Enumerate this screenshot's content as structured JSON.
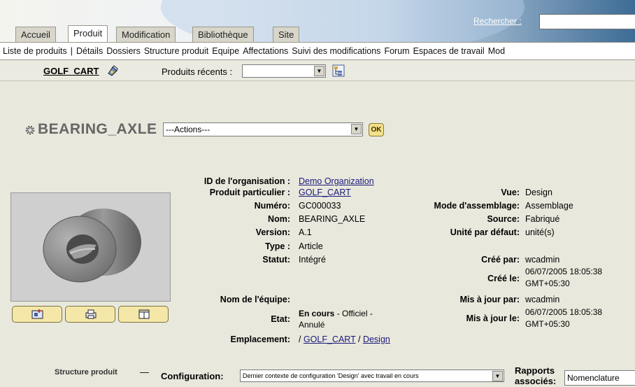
{
  "tabs": [
    {
      "label": "Accueil",
      "active": false
    },
    {
      "label": "Produit",
      "active": true
    },
    {
      "label": "Modification",
      "active": false
    },
    {
      "label": "Bibliothèque",
      "active": false
    },
    {
      "label": "Site",
      "active": false
    }
  ],
  "search": {
    "label": "Rechercher :",
    "value": ""
  },
  "subnav": [
    "Liste de produits",
    "|",
    "Détails",
    "Dossiers",
    "Structure produit",
    "Equipe",
    "Affectations",
    "Suivi des modifications",
    "Forum",
    "Espaces de travail",
    "Mod"
  ],
  "context": {
    "product": "GOLF_CART",
    "recent_label": "Produits récents :",
    "recent_value": ""
  },
  "title": "BEARING_AXLE",
  "actions": {
    "value": "---Actions---",
    "ok_label": "OK"
  },
  "attributes_left": [
    {
      "label": "ID de l'organisation :",
      "value": "Demo Organization",
      "link": true
    },
    {
      "label": "Produit particulier :",
      "value": "GOLF_CART",
      "link": true
    },
    {
      "label": "Numéro:",
      "value": "GC000033"
    },
    {
      "label": "Nom:",
      "value": "BEARING_AXLE"
    },
    {
      "label": "Version:",
      "value": "A.1"
    },
    {
      "label": "Type :",
      "value": "Article"
    },
    {
      "label": "Statut:",
      "value": "Intégré"
    }
  ],
  "attributes_right": [
    {
      "label": "Vue:",
      "value": "Design"
    },
    {
      "label": "Mode d'assemblage:",
      "value": "Assemblage"
    },
    {
      "label": "Source:",
      "value": "Fabriqué"
    },
    {
      "label": "Unité par défaut:",
      "value": "unité(s)"
    }
  ],
  "team": {
    "label": "Nom de l'équipe:",
    "value": ""
  },
  "etat": {
    "label": "Etat:",
    "value_bold": "En cours",
    "value_rest": " - Officiel -",
    "value_line2": "Annulé"
  },
  "emplacement": {
    "label": "Emplacement:",
    "prefix": "/ ",
    "link1": "GOLF_CART",
    "sep": " / ",
    "link2": "Design"
  },
  "history": {
    "created_by_label": "Créé par:",
    "created_by": "wcadmin",
    "created_on_label": "Créé le:",
    "created_on_1": "06/07/2005 18:05:38",
    "created_on_2": "GMT+05:30",
    "updated_by_label": "Mis à jour par:",
    "updated_by": "wcadmin",
    "updated_on_label": "Mis à jour le:",
    "updated_on_1": "06/07/2005 18:05:38",
    "updated_on_2": "GMT+05:30"
  },
  "bottom": {
    "structure_label": "Structure produit",
    "structure_toggle": "—",
    "config_label": "Configuration:",
    "config_value": "Dernier contexte de configuration 'Design' avec travail en cours",
    "reports_label_1": "Rapports",
    "reports_label_2": "associés:",
    "reports_value": "Nomenclature"
  },
  "colors": {
    "banner_dark": "#3d6c96",
    "page_bg": "#e9e8dd",
    "button_yellow": "#f4e7a8",
    "link": "#1a1a7a"
  }
}
